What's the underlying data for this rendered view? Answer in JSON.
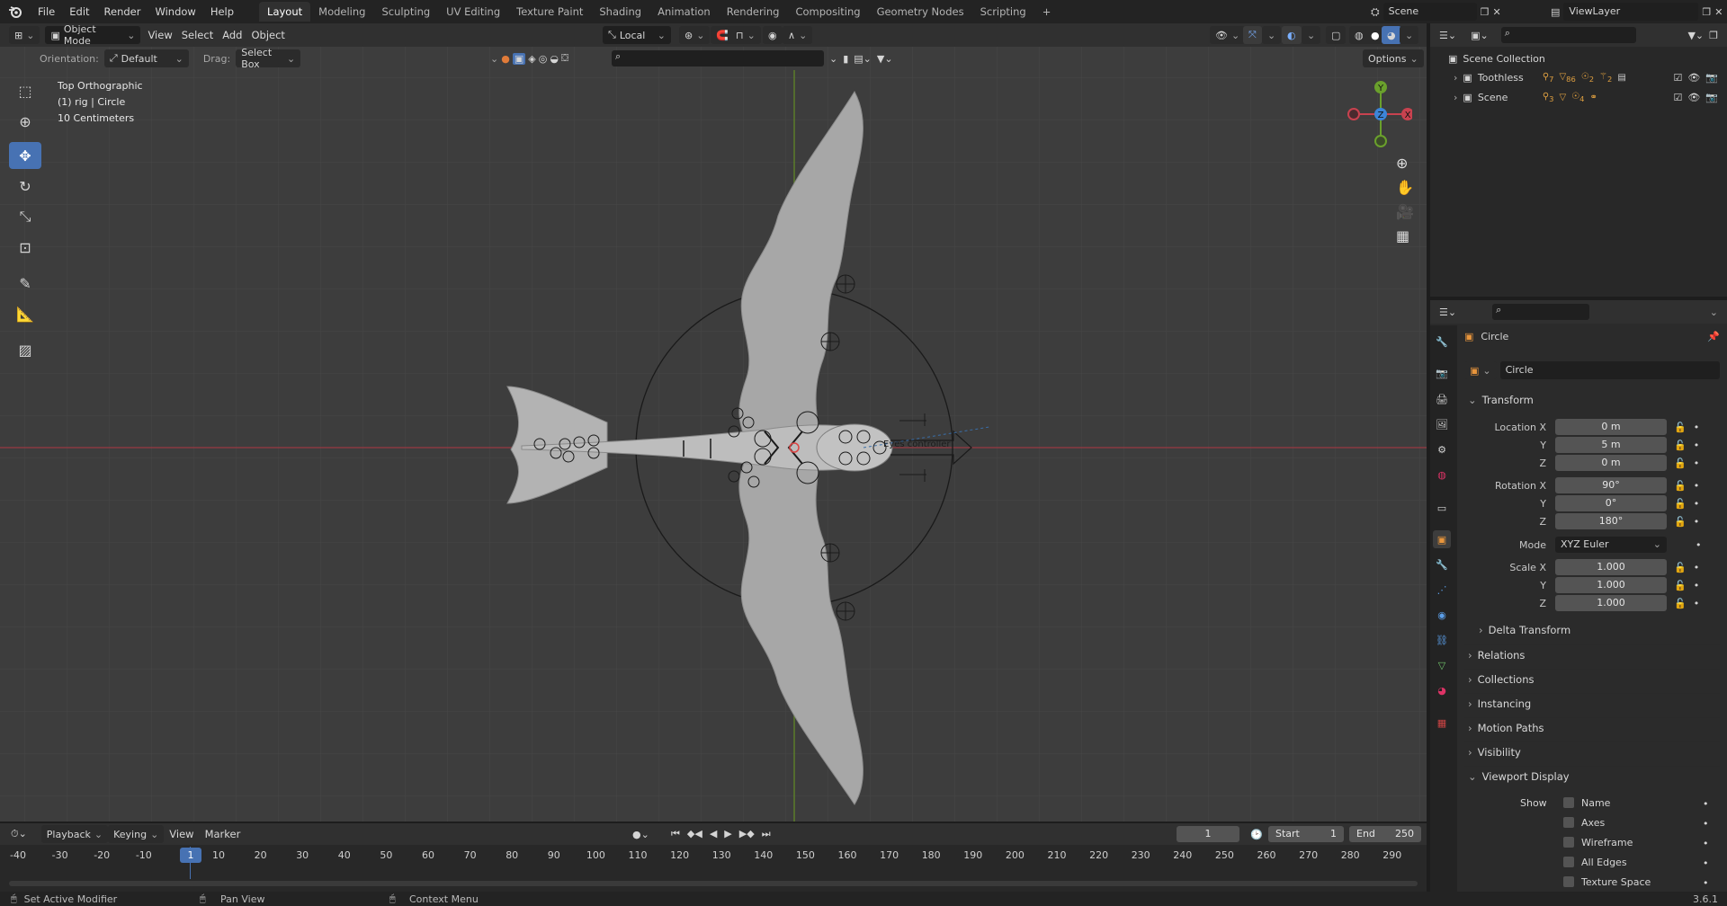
{
  "menu": {
    "file": "File",
    "edit": "Edit",
    "render": "Render",
    "window": "Window",
    "help": "Help"
  },
  "workspaces": [
    "Layout",
    "Modeling",
    "Sculpting",
    "UV Editing",
    "Texture Paint",
    "Shading",
    "Animation",
    "Rendering",
    "Compositing",
    "Geometry Nodes",
    "Scripting",
    "+"
  ],
  "scene": {
    "name": "Scene",
    "view_layer": "ViewLayer"
  },
  "viewport_header": {
    "mode": "Object Mode",
    "view": "View",
    "select": "Select",
    "add": "Add",
    "object": "Object",
    "transform_space": "Local",
    "options": "Options",
    "orientation_label": "Orientation:",
    "orientation_value": "Default",
    "drag_label": "Drag:",
    "drag_value": "Select Box"
  },
  "viewport_overlay": {
    "view_name": "Top Orthographic",
    "object_info": "(1) rig | Circle",
    "scale": "10 Centimeters",
    "controller_label": "Eyes controller"
  },
  "gizmo": {
    "y": "Y",
    "z": "Z",
    "x": "X"
  },
  "outliner": {
    "root": "Scene Collection",
    "items": [
      {
        "name": "Toothless",
        "counts": [
          "7",
          "86",
          "2",
          "2"
        ]
      },
      {
        "name": "Scene",
        "counts": [
          "3",
          "4"
        ]
      }
    ]
  },
  "properties": {
    "object_name": "Circle",
    "datablock_name": "Circle",
    "transform_title": "Transform",
    "location": {
      "label": "Location X",
      "x": "0 m",
      "y": "5 m",
      "z": "0 m"
    },
    "rotation": {
      "label": "Rotation X",
      "x": "90°",
      "y": "0°",
      "z": "180°"
    },
    "mode": {
      "label": "Mode",
      "value": "XYZ Euler"
    },
    "scale": {
      "label": "Scale X",
      "x": "1.000",
      "y": "1.000",
      "z": "1.000"
    },
    "axis_y": "Y",
    "axis_z": "Z",
    "sections": [
      "Delta Transform",
      "Relations",
      "Collections",
      "Instancing",
      "Motion Paths",
      "Visibility"
    ],
    "viewport_display": {
      "title": "Viewport Display",
      "show_label": "Show",
      "checkboxes": [
        "Name",
        "Axes",
        "Wireframe",
        "All Edges",
        "Texture Space"
      ]
    }
  },
  "timeline": {
    "playback": "Playback",
    "keying": "Keying",
    "view": "View",
    "marker": "Marker",
    "current_frame": "1",
    "start_label": "Start",
    "start": "1",
    "end_label": "End",
    "end": "250",
    "ticks": [
      "-40",
      "-30",
      "-20",
      "-10",
      "1",
      "10",
      "20",
      "30",
      "40",
      "50",
      "60",
      "70",
      "80",
      "90",
      "100",
      "110",
      "120",
      "130",
      "140",
      "150",
      "160",
      "170",
      "180",
      "190",
      "200",
      "210",
      "220",
      "230",
      "240",
      "250",
      "260",
      "270",
      "280",
      "290"
    ]
  },
  "status_bar": {
    "left": "Set Active Modifier",
    "middle": "Pan View",
    "right": "Context Menu",
    "version": "3.6.1"
  },
  "colors": {
    "accent": "#4772b3",
    "x_axis": "#c8424f",
    "y_axis": "#6aa02c",
    "z_axis": "#3c85d8",
    "viewport_bg": "#3d3d3d"
  }
}
